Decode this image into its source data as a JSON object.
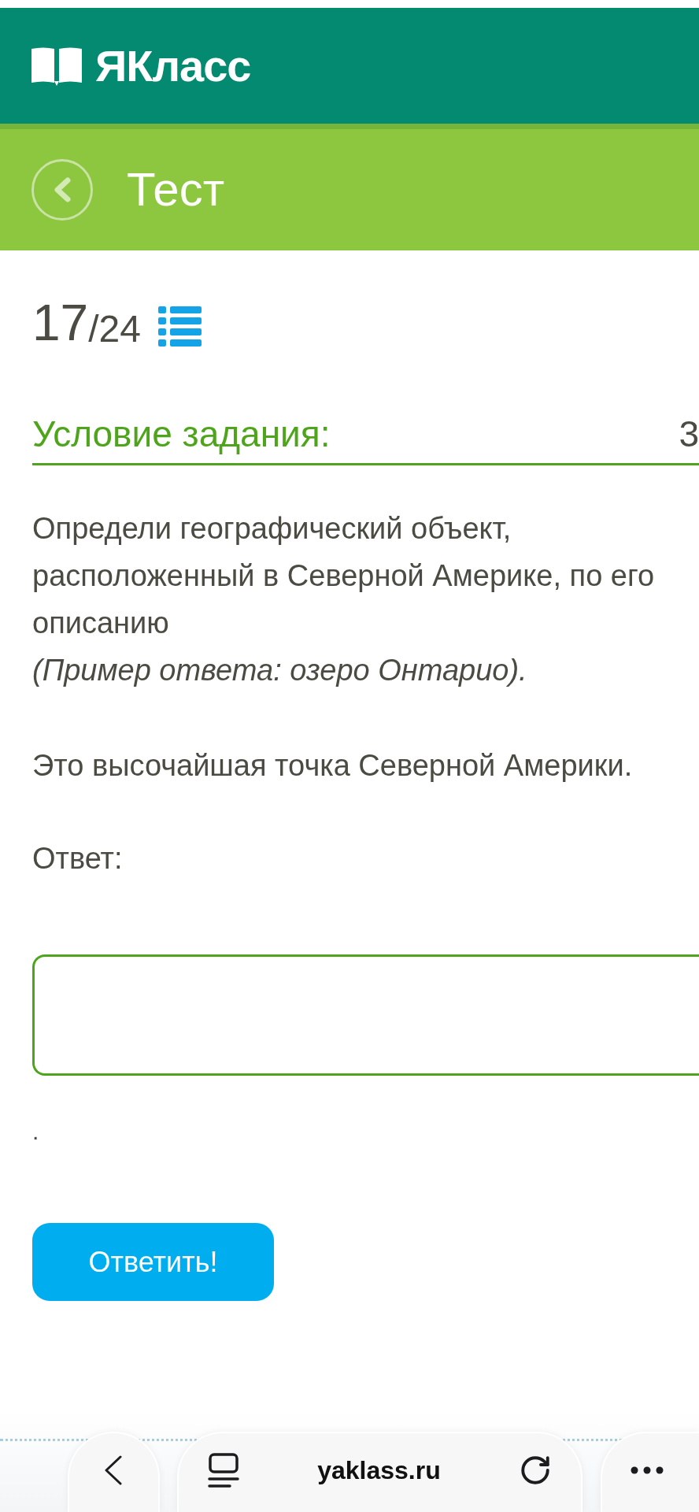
{
  "header": {
    "logo_text": "ЯКласс"
  },
  "title_bar": {
    "title": "Тест"
  },
  "progress": {
    "current": "17",
    "total": "/24"
  },
  "task": {
    "heading": "Условие задания:",
    "right_text": "3",
    "description": "Определи географический объект, расположенный в Северной Америке, по его описанию",
    "example": "(Пример ответа: озеро Онтарио).",
    "question": "Это высочайшая точка Северной Америки.",
    "answer_label": "Ответ:",
    "after_field": ".",
    "submit_button": "Ответить!"
  },
  "browser_bar": {
    "url": "yaklass.ru"
  }
}
